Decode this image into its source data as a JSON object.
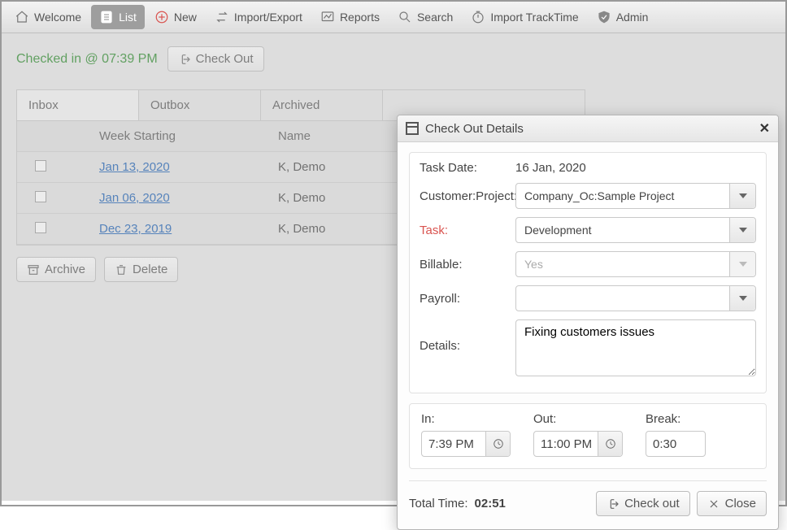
{
  "toolbar": {
    "welcome": "Welcome",
    "list": "List",
    "new": "New",
    "import_export": "Import/Export",
    "reports": "Reports",
    "search": "Search",
    "import_tracktime": "Import TrackTime",
    "admin": "Admin"
  },
  "checkin": {
    "status_text": "Checked in @ 07:39 PM",
    "checkout_btn": "Check Out"
  },
  "tabs": {
    "inbox": "Inbox",
    "outbox": "Outbox",
    "archived": "Archived"
  },
  "grid": {
    "head_week": "Week Starting",
    "head_name": "Name",
    "rows": [
      {
        "week": "Jan 13, 2020",
        "name": "K, Demo"
      },
      {
        "week": "Jan 06, 2020",
        "name": "K, Demo"
      },
      {
        "week": "Dec 23, 2019",
        "name": "K, Demo"
      }
    ]
  },
  "actions": {
    "archive": "Archive",
    "delete": "Delete"
  },
  "dialog": {
    "title": "Check Out Details",
    "labels": {
      "task_date": "Task Date:",
      "customer_project": "Customer:Project:",
      "task": "Task:",
      "billable": "Billable:",
      "payroll": "Payroll:",
      "details": "Details:",
      "in": "In:",
      "out": "Out:",
      "break": "Break:",
      "total_time": "Total Time:"
    },
    "values": {
      "task_date": "16 Jan, 2020",
      "customer_project": "Company_Oc:Sample Project",
      "task": "Development",
      "billable": "Yes",
      "payroll": "",
      "details": "Fixing customers issues",
      "in": "7:39 PM",
      "out": "11:00 PM",
      "break": "0:30",
      "total_time": "02:51"
    },
    "buttons": {
      "check_out": "Check out",
      "close": "Close"
    }
  }
}
